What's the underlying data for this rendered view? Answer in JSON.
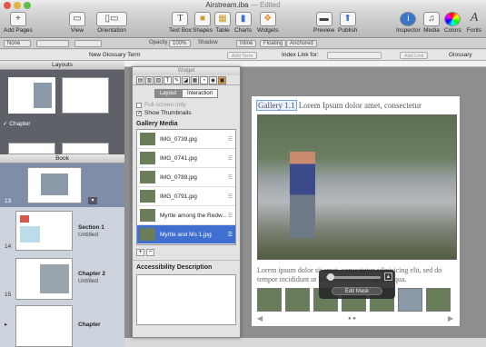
{
  "window": {
    "title": "Airstream.iba",
    "status": "— Edited"
  },
  "toolbar": {
    "add_pages": "Add Pages",
    "view": "View",
    "orientation": "Orientation",
    "text_box": "Text Box",
    "shapes": "Shapes",
    "table": "Table",
    "charts": "Charts",
    "widgets": "Widgets",
    "preview": "Preview",
    "publish": "Publish",
    "inspector": "Inspector",
    "media": "Media",
    "colors": "Colors",
    "fonts": "Fonts"
  },
  "formatbar": {
    "style": "None",
    "opacity_label": "Opacity",
    "opacity": "100%",
    "shadow": "Shadow",
    "inline": "Inline",
    "floating": "Floating",
    "anchored": "Anchored"
  },
  "glossary_bar": {
    "new_term_label": "New Glossary Term",
    "add_term": "Add Term",
    "index_link_label": "Index Link for:",
    "add_link": "Add Link",
    "glossary": "Glossary"
  },
  "sidebar": {
    "layouts_header": "Layouts",
    "layout_chapter": "Chapter",
    "book_header": "Book",
    "pages": [
      {
        "num": "13",
        "title": "",
        "subtitle": ""
      },
      {
        "num": "14",
        "title": "Section 1",
        "subtitle": "Untitled"
      },
      {
        "num": "15",
        "title": "Chapter 2",
        "subtitle": "Untitled"
      },
      {
        "num": "",
        "title": "Chapter",
        "subtitle": ""
      }
    ]
  },
  "widget_panel": {
    "title": "Widget",
    "tabs": [
      "Layout",
      "Interaction"
    ],
    "full_screen_only": "Full-screen only",
    "show_thumbnails": "Show Thumbnails",
    "gallery_media_label": "Gallery Media",
    "media": [
      "IMG_0739.jpg",
      "IMG_0741.jpg",
      "IMG_0789.jpg",
      "IMG_0791.jpg",
      "Myrtle among the Redw...",
      "Myrtle and Ms 1.jpg"
    ],
    "accessibility_label": "Accessibility Description"
  },
  "document": {
    "gallery_label": "Gallery 1.1",
    "caption_title": "Lorem Ipsum dolor amet, consectetur",
    "body_text": "Lorem ipsum dolor sit amet, consectetur adipisicing elit, sed do tempor incididunt ut labore et dolore magna aliqua.",
    "edit_mask": "Edit Mask"
  }
}
